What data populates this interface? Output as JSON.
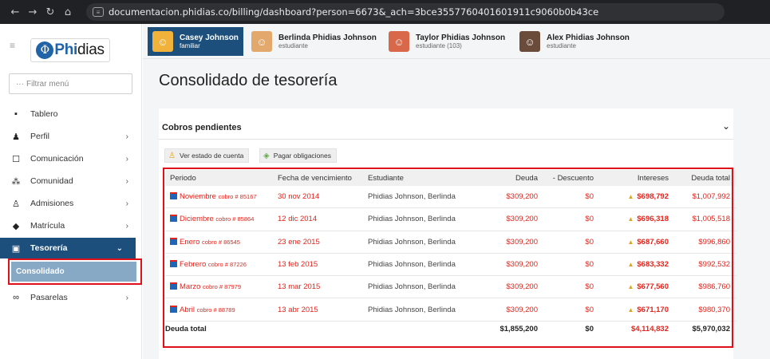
{
  "browser": {
    "back_icon": "back-arrow-icon",
    "forward_icon": "forward-arrow-icon",
    "reload_icon": "reload-icon",
    "home_icon": "home-icon",
    "url": "documentacion.phidias.co/billing/dashboard?person=6673&_ach=3bce3557760401601911c9060b0b43ce"
  },
  "sidebar": {
    "logo_text_phi": "Phi",
    "logo_text_rest": "dias",
    "filter_placeholder": "Filtrar menú",
    "items": [
      {
        "label": "Tablero",
        "icon": "dashboard-icon",
        "has_chevron": false
      },
      {
        "label": "Perfil",
        "icon": "person-icon",
        "has_chevron": true
      },
      {
        "label": "Comunicación",
        "icon": "message-icon",
        "has_chevron": true
      },
      {
        "label": "Comunidad",
        "icon": "group-icon",
        "has_chevron": true
      },
      {
        "label": "Admisiones",
        "icon": "admissions-icon",
        "has_chevron": true
      },
      {
        "label": "Matrícula",
        "icon": "graduation-cap-icon",
        "has_chevron": true
      },
      {
        "label": "Tesorería",
        "icon": "treasury-icon",
        "has_chevron": true,
        "active": true
      },
      {
        "label": "Pasarelas",
        "icon": "link-icon",
        "has_chevron": true
      }
    ],
    "submenu": {
      "label": "Consolidado"
    }
  },
  "profiles": [
    {
      "name": "Casey Johnson",
      "role": "familiar",
      "active": true
    },
    {
      "name": "Berlinda Phidias Johnson",
      "role": "estudiante",
      "active": false
    },
    {
      "name": "Taylor Phidias Johnson",
      "role": "estudiante (103)",
      "active": false
    },
    {
      "name": "Alex Phidias Johnson",
      "role": "estudiante",
      "active": false
    }
  ],
  "main": {
    "title": "Consolidado de tesorería",
    "section_title": "Cobros pendientes",
    "buttons": {
      "estado": "Ver estado de cuenta",
      "pagar": "Pagar obligaciones"
    },
    "table": {
      "headers": [
        "Periodo",
        "Fecha de vencimiento",
        "Estudiante",
        "Deuda",
        "- Descuento",
        "Intereses",
        "Deuda total"
      ],
      "rows": [
        {
          "periodo": "Noviembre",
          "cobro": "cobro # 85167",
          "fecha": "30 nov 2014",
          "estudiante": "Phidias Johnson, Berlinda",
          "deuda": "$309,200",
          "descuento": "$0",
          "intereses": "$698,792",
          "total": "$1,007,992"
        },
        {
          "periodo": "Diciembre",
          "cobro": "cobro # 85864",
          "fecha": "12 dic 2014",
          "estudiante": "Phidias Johnson, Berlinda",
          "deuda": "$309,200",
          "descuento": "$0",
          "intereses": "$696,318",
          "total": "$1,005,518"
        },
        {
          "periodo": "Enero",
          "cobro": "cobro # 86545",
          "fecha": "23 ene 2015",
          "estudiante": "Phidias Johnson, Berlinda",
          "deuda": "$309,200",
          "descuento": "$0",
          "intereses": "$687,660",
          "total": "$996,860"
        },
        {
          "periodo": "Febrero",
          "cobro": "cobro # 87226",
          "fecha": "13 feb 2015",
          "estudiante": "Phidias Johnson, Berlinda",
          "deuda": "$309,200",
          "descuento": "$0",
          "intereses": "$683,332",
          "total": "$992,532"
        },
        {
          "periodo": "Marzo",
          "cobro": "cobro # 87979",
          "fecha": "13 mar 2015",
          "estudiante": "Phidias Johnson, Berlinda",
          "deuda": "$309,200",
          "descuento": "$0",
          "intereses": "$677,560",
          "total": "$986,760"
        },
        {
          "periodo": "Abril",
          "cobro": "cobro # 88789",
          "fecha": "13 abr 2015",
          "estudiante": "Phidias Johnson, Berlinda",
          "deuda": "$309,200",
          "descuento": "$0",
          "intereses": "$671,170",
          "total": "$980,370"
        }
      ],
      "footer": {
        "label": "Deuda total",
        "deuda": "$1,855,200",
        "descuento": "$0",
        "intereses": "$4,114,832",
        "total": "$5,970,032"
      }
    }
  },
  "colors": {
    "brand_blue": "#1c4f7c",
    "accent_red": "#e5231b",
    "highlight_box": "#e0101a",
    "submenu_bg": "#88a9c5"
  }
}
